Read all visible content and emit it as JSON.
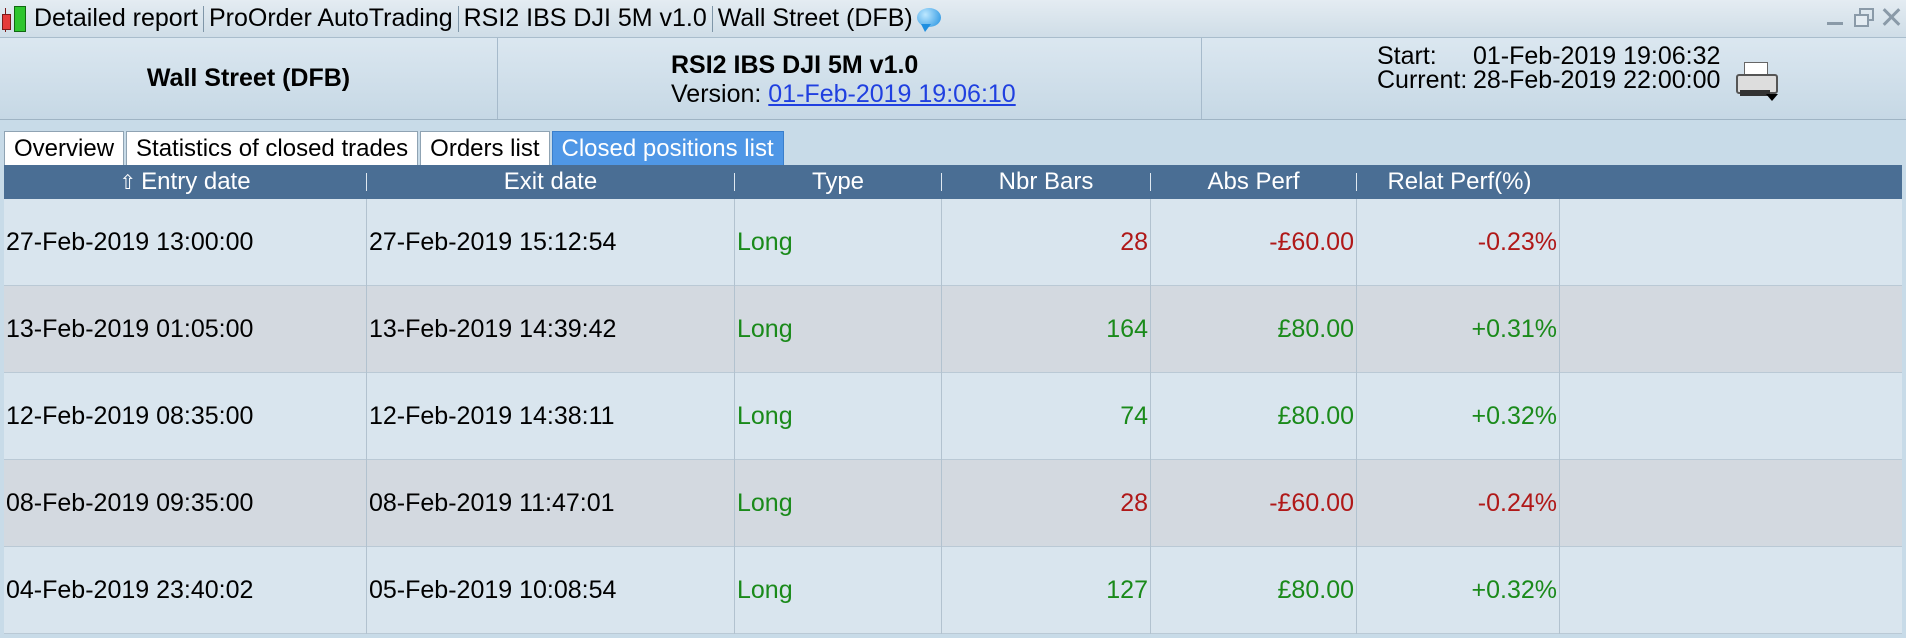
{
  "window": {
    "title_segments": [
      "Detailed report",
      "ProOrder AutoTrading",
      "RSI2 IBS DJI 5M v1.0",
      "Wall Street (DFB)"
    ]
  },
  "header": {
    "instrument": "Wall Street (DFB)",
    "system_name": "RSI2 IBS DJI 5M v1.0",
    "version_label": "Version:",
    "version_value": "01-Feb-2019 19:06:10",
    "start_label": "Start:",
    "start_value": "01-Feb-2019 19:06:32",
    "current_label": "Current:",
    "current_value": "28-Feb-2019 22:00:00"
  },
  "tabs": [
    {
      "label": "Overview",
      "active": false
    },
    {
      "label": "Statistics of closed trades",
      "active": false
    },
    {
      "label": "Orders list",
      "active": false
    },
    {
      "label": "Closed positions list",
      "active": true
    }
  ],
  "table": {
    "columns": [
      "Entry date",
      "Exit date",
      "Type",
      "Nbr Bars",
      "Abs Perf",
      "Relat Perf(%)"
    ],
    "sort_icon": "sort-up-arrow-icon",
    "rows": [
      {
        "entry": "27-Feb-2019 13:00:00",
        "exit": "27-Feb-2019 15:12:54",
        "type": "Long",
        "bars": "28",
        "abs": "-£60.00",
        "rel": "-0.23%",
        "positive": false
      },
      {
        "entry": "13-Feb-2019 01:05:00",
        "exit": "13-Feb-2019 14:39:42",
        "type": "Long",
        "bars": "164",
        "abs": "£80.00",
        "rel": "+0.31%",
        "positive": true
      },
      {
        "entry": "12-Feb-2019 08:35:00",
        "exit": "12-Feb-2019 14:38:11",
        "type": "Long",
        "bars": "74",
        "abs": "£80.00",
        "rel": "+0.32%",
        "positive": true
      },
      {
        "entry": "08-Feb-2019 09:35:00",
        "exit": "08-Feb-2019 11:47:01",
        "type": "Long",
        "bars": "28",
        "abs": "-£60.00",
        "rel": "-0.24%",
        "positive": false
      },
      {
        "entry": "04-Feb-2019 23:40:02",
        "exit": "05-Feb-2019 10:08:54",
        "type": "Long",
        "bars": "127",
        "abs": "£80.00",
        "rel": "+0.32%",
        "positive": true
      }
    ]
  },
  "colors": {
    "positive": "#1a8a1a",
    "negative": "#b01818",
    "type_long": "#1a8a1a",
    "header_bg": "#4a6e94",
    "active_tab": "#4f97e6"
  }
}
